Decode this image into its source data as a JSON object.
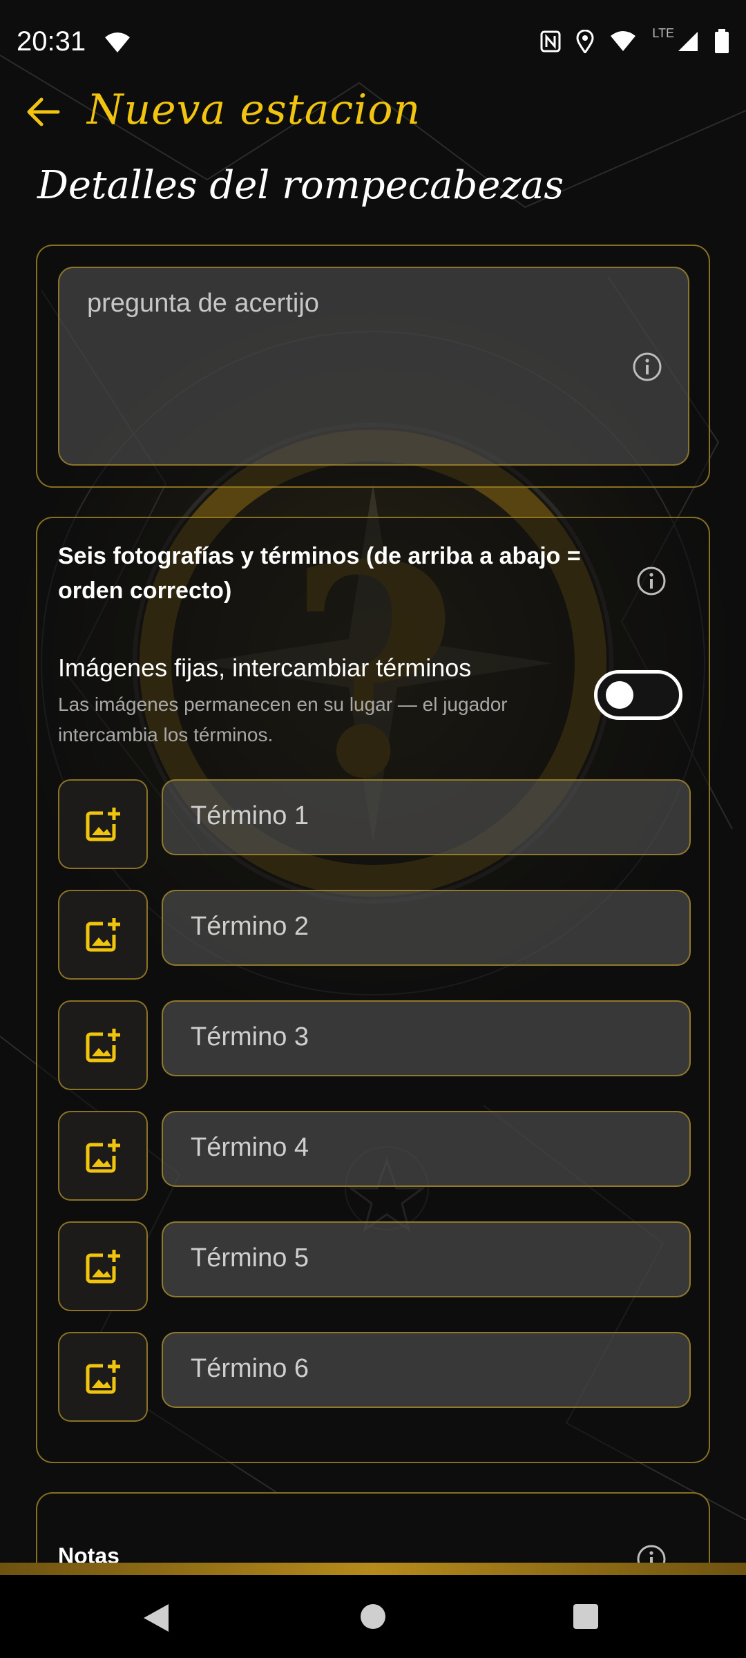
{
  "status_bar": {
    "time": "20:31",
    "network": "LTE"
  },
  "app_bar": {
    "title": "Nueva estacion",
    "back_icon": "arrow-left-icon"
  },
  "section_title": "Detalles del rompecabezas",
  "question_card": {
    "placeholder": "pregunta de acertijo",
    "info_icon": "info-icon"
  },
  "puzzle_card": {
    "heading": "Seis fotografías y términos (de arriba a abajo = orden correcto)",
    "toggle": {
      "title": "Imágenes fijas, intercambiar términos",
      "description": "Las imágenes permanecen en su lugar — el jugador intercambia los términos.",
      "state": "off"
    },
    "terms": [
      {
        "placeholder": "Término 1",
        "icon": "add-photo-icon"
      },
      {
        "placeholder": "Término 2",
        "icon": "add-photo-icon"
      },
      {
        "placeholder": "Término 3",
        "icon": "add-photo-icon"
      },
      {
        "placeholder": "Término 4",
        "icon": "add-photo-icon"
      },
      {
        "placeholder": "Término 5",
        "icon": "add-photo-icon"
      },
      {
        "placeholder": "Término 6",
        "icon": "add-photo-icon"
      }
    ]
  },
  "notes_card": {
    "label": "Notas"
  },
  "colors": {
    "accent": "#f1c40f",
    "border": "#b09028",
    "background": "#0d0d0d"
  }
}
